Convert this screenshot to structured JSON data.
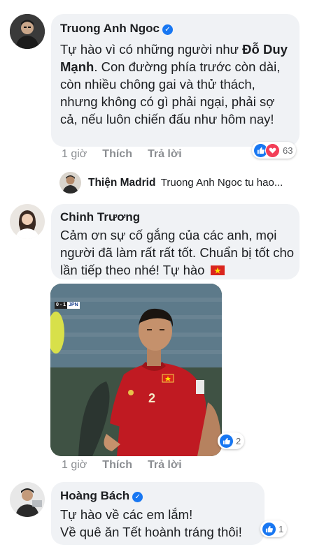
{
  "comments": [
    {
      "author": "Truong Anh Ngoc",
      "verified": true,
      "text_parts": [
        "Tự hào vì có những người như ",
        "Đỗ Duy Mạnh",
        ". Con đường phía trước còn dài, còn nhiều chông gai và thử thách, nhưng không có gì phải ngại, phải sợ cả, nếu luôn chiến đấu như hôm nay!"
      ],
      "time": "1 giờ",
      "like_label": "Thích",
      "reply_label": "Trả lời",
      "reaction_count": "63"
    },
    {
      "author": "Chinh Trương",
      "verified": false,
      "text": "Cảm ơn sự cố gắng của các anh, mọi người đã làm rất rất tốt. Chuẩn bị tốt cho lần tiếp theo nhé! Tự hào",
      "time": "1 giờ",
      "like_label": "Thích",
      "reply_label": "Trả lời",
      "reaction_count": "2",
      "photo": {
        "score": "0 - 1",
        "team": "JPN",
        "jersey_number": "2"
      }
    },
    {
      "author": "Hoàng Bách",
      "verified": true,
      "text_line1": "Tự hào về các em lắm!",
      "text_line2": "Về quê ăn Tết hoành tráng thôi!",
      "reaction_count": "1"
    }
  ],
  "reply_preview": {
    "author": "Thiện Madrid",
    "snippet": "Truong Anh Ngoc tu hao..."
  },
  "colors": {
    "bubble": "#f0f2f5",
    "accent": "#1877f2",
    "love": "#f33e58",
    "meta": "#8a8d91"
  }
}
